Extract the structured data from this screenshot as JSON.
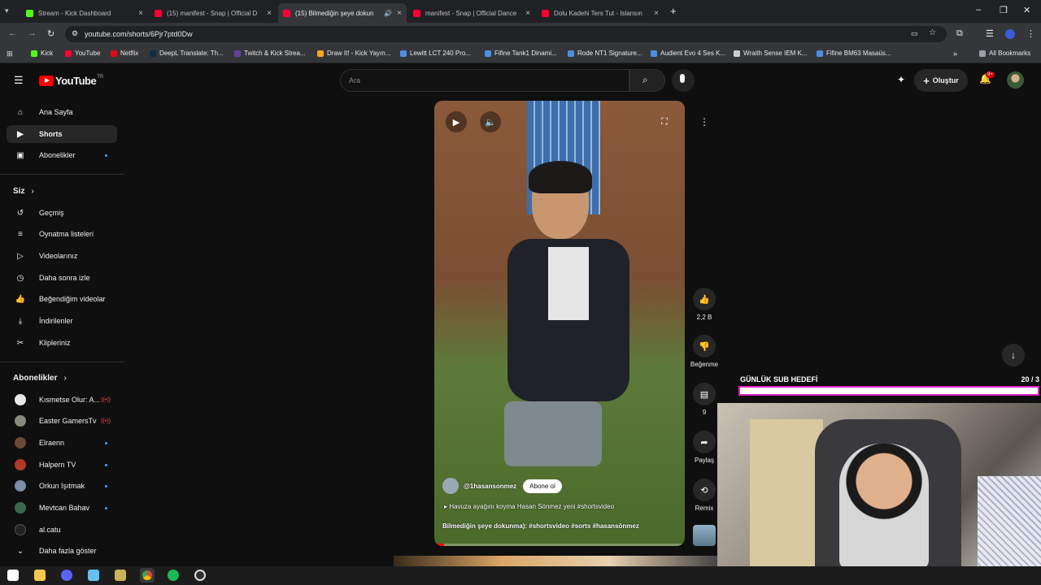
{
  "browser": {
    "tabs": [
      {
        "title": "Stream - Kick Dashboard",
        "color": "#53fc18"
      },
      {
        "title": "(15) manifest - Snap | Official D",
        "color": "#ff0033"
      },
      {
        "title": "(15) Bilmediğin şeye dokun",
        "color": "#ff0033",
        "active": true
      },
      {
        "title": "manifest - Snap | Official Dance",
        "color": "#ff0033"
      },
      {
        "title": "Dolu Kadehi Ters Tut - Islansın",
        "color": "#ff0033"
      }
    ],
    "new_tab": "+",
    "url": "youtube.com/shorts/6Pjr7ptd0Dw",
    "bookmarks": [
      "Kick",
      "YouTube",
      "Netflix",
      "DeepL Translate: Th...",
      "Twitch & Kick Strea...",
      "Draw It! - Kick Yayın...",
      "Lewitt LCT 240 Pro...",
      "Fifine Tank1 Dinami...",
      "Rode NT1 Signature...",
      "Audient Evo 4 Ses K...",
      "Wraith Sense IEM K...",
      "Fifine BM63 Masaüs..."
    ],
    "all_bookmarks": "All Bookmarks"
  },
  "youtube": {
    "logo": "YouTube",
    "region": "TR",
    "search_placeholder": "Ara",
    "create_label": "Oluştur",
    "notif_count": "9+",
    "sidebar": {
      "main": [
        "Ana Sayfa",
        "Shorts",
        "Abonelikler"
      ],
      "you_header": "Siz",
      "you": [
        "Geçmiş",
        "Oynatma listeleri",
        "Videolarınız",
        "Daha sonra izle",
        "Beğendiğim videolar",
        "İndirilenler",
        "Klipleriniz"
      ],
      "subs_header": "Abonelikler",
      "subs": [
        "Kısmetse Olur: A...",
        "Easter GamersTv",
        "Elraenn",
        "Halpern TV",
        "Orkun Işıtmak",
        "Mevtcan Bahav",
        "al.catu"
      ],
      "show_more": "Daha fazla göster"
    },
    "short": {
      "channel": "@1hasansonmez",
      "subscribe": "Abone ol",
      "title": "Havuza ayağını koyma Hasan Sönmez yeni #shortsvideo",
      "caption": "Bilmediğin şeye dokunma): #shortsvideo #sorts #hasansönmez"
    },
    "actions": {
      "likes": "2,2 B",
      "dislike": "Beğenme",
      "comments": "9",
      "share": "Paylaş",
      "remix": "Remix"
    }
  },
  "overlay": {
    "goal_title": "GÜNLÜK SUB HEDEFİ",
    "goal_count": "20 / 3"
  }
}
